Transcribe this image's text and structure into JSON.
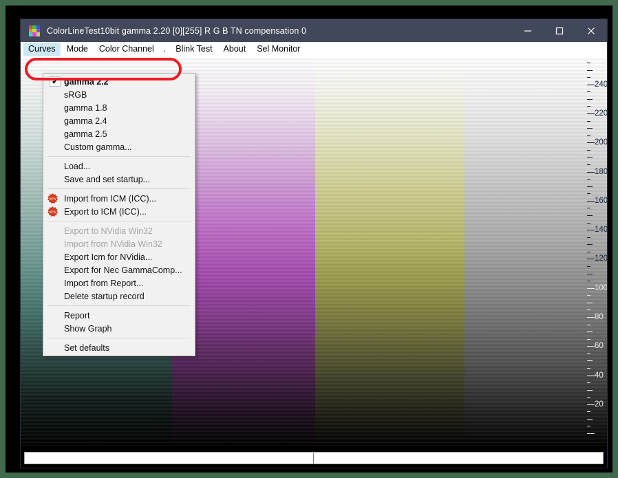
{
  "window": {
    "title": "ColorLineTest10bit gamma 2.20 [0][255]   R G B  TN compensation 0",
    "app_icon": "color-grid-icon",
    "titlebar_color": "#414859",
    "controls": {
      "minimize": "minimize-icon",
      "maximize": "maximize-icon",
      "close": "close-icon"
    }
  },
  "menubar": {
    "items": [
      {
        "label": "Curves",
        "active": true
      },
      {
        "label": "Mode",
        "active": false
      },
      {
        "label": "Color Channel",
        "active": false
      },
      {
        "label": ".",
        "active": false
      },
      {
        "label": "Blink Test",
        "active": false
      },
      {
        "label": "About",
        "active": false
      },
      {
        "label": "Sel Monitor",
        "active": false
      }
    ]
  },
  "dropdown": {
    "owner": "Curves",
    "groups": [
      {
        "items": [
          {
            "label": "gamma 2.2",
            "checked": true,
            "bold": true,
            "disabled": false,
            "icon": null
          },
          {
            "label": "sRGB",
            "checked": false,
            "bold": false,
            "disabled": false,
            "icon": null
          },
          {
            "label": "gamma 1.8",
            "checked": false,
            "bold": false,
            "disabled": false,
            "icon": null
          },
          {
            "label": "gamma 2.4",
            "checked": false,
            "bold": false,
            "disabled": false,
            "icon": null
          },
          {
            "label": "gamma 2.5",
            "checked": false,
            "bold": false,
            "disabled": false,
            "icon": null
          },
          {
            "label": "Custom gamma...",
            "checked": false,
            "bold": false,
            "disabled": false,
            "icon": null
          }
        ]
      },
      {
        "items": [
          {
            "label": "Load...",
            "checked": false,
            "bold": false,
            "disabled": false,
            "icon": null
          },
          {
            "label": "Save and set startup...",
            "checked": false,
            "bold": false,
            "disabled": false,
            "icon": null
          }
        ]
      },
      {
        "items": [
          {
            "label": "Import from ICM (ICC)...",
            "checked": false,
            "bold": false,
            "disabled": false,
            "icon": "new-badge-icon"
          },
          {
            "label": "Export to ICM (ICC)...",
            "checked": false,
            "bold": false,
            "disabled": false,
            "icon": "new-badge-icon"
          }
        ]
      },
      {
        "items": [
          {
            "label": "Export to NVidia Win32",
            "checked": false,
            "bold": false,
            "disabled": true,
            "icon": null
          },
          {
            "label": "Import from NVidia Win32",
            "checked": false,
            "bold": false,
            "disabled": true,
            "icon": null
          },
          {
            "label": "Export Icm for NVidia...",
            "checked": false,
            "bold": false,
            "disabled": false,
            "icon": null
          },
          {
            "label": "Export for Nec GammaComp...",
            "checked": false,
            "bold": false,
            "disabled": false,
            "icon": null
          },
          {
            "label": "Import from Report...",
            "checked": false,
            "bold": false,
            "disabled": false,
            "icon": null
          },
          {
            "label": "Delete startup record",
            "checked": false,
            "bold": false,
            "disabled": false,
            "icon": null
          }
        ]
      },
      {
        "items": [
          {
            "label": "Report",
            "checked": false,
            "bold": false,
            "disabled": false,
            "icon": null
          },
          {
            "label": "Show Graph",
            "checked": false,
            "bold": false,
            "disabled": false,
            "icon": null
          }
        ]
      },
      {
        "items": [
          {
            "label": "Set defaults",
            "checked": false,
            "bold": false,
            "disabled": false,
            "icon": null
          }
        ]
      }
    ]
  },
  "annotation": {
    "shape": "rounded-rectangle",
    "color": "#ec1c24",
    "target": "gamma 2.2"
  },
  "ruler": {
    "axis_max": 255,
    "axis_min": 0,
    "major_step": 20,
    "minor_step": 5,
    "labels": [
      240,
      220,
      200,
      180,
      160,
      140,
      120,
      100,
      80,
      60,
      40,
      20
    ]
  },
  "canvas": {
    "description": "vertical gradient test pattern, white at top to black at bottom, split into four vertical color bands",
    "bands": [
      {
        "name": "teal-band",
        "top_color": "#ffffff",
        "mid_color": "#3e6f66",
        "bottom_color": "#000000"
      },
      {
        "name": "magenta-band",
        "top_color": "#ffffff",
        "mid_color": "#9a3fa0",
        "bottom_color": "#000000"
      },
      {
        "name": "olive-band",
        "top_color": "#ffffff",
        "mid_color": "#8a8a3c",
        "bottom_color": "#000000"
      },
      {
        "name": "gray-band",
        "top_color": "#ffffff",
        "mid_color": "#8a8a8a",
        "bottom_color": "#000000"
      }
    ]
  },
  "scrollbar": {
    "name": "horizontal-scrollbar",
    "thumb_fraction": 0.5
  }
}
